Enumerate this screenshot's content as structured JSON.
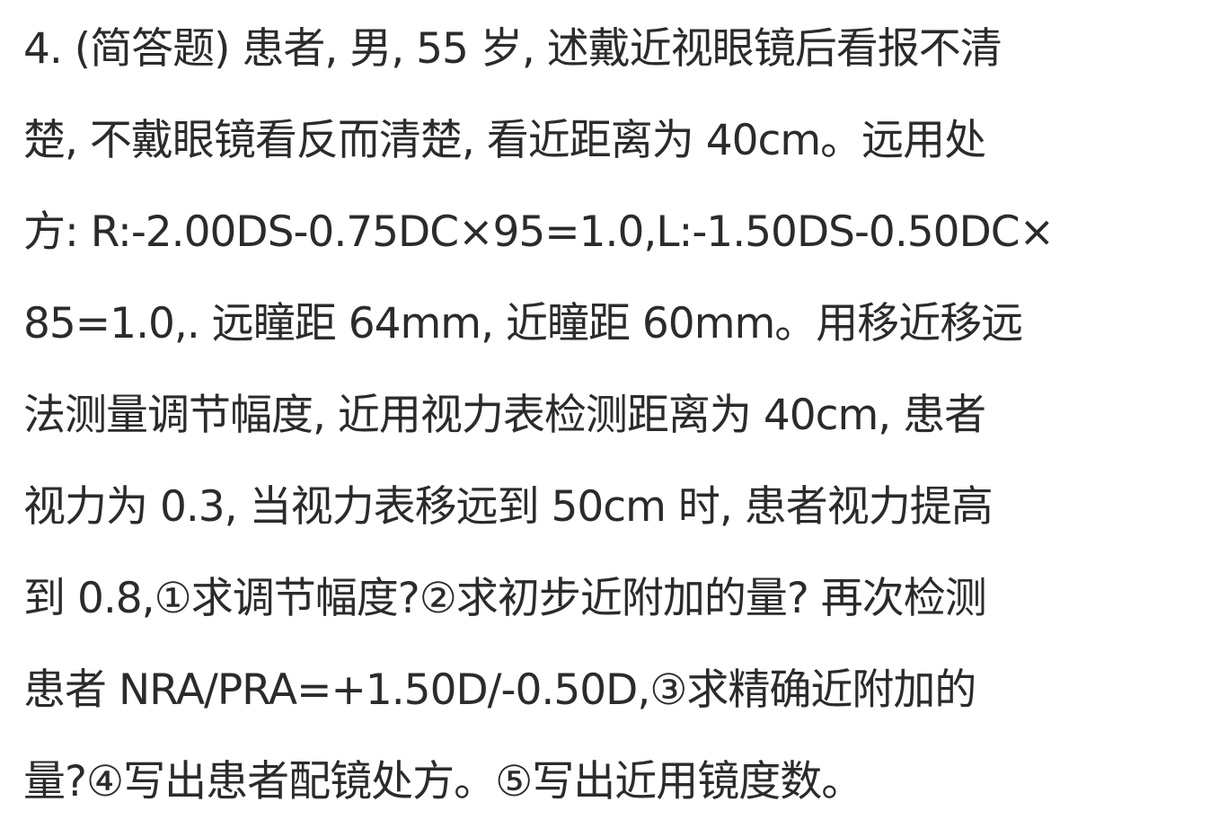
{
  "question": {
    "lines": [
      "4. (简答题) 患者, 男, 55 岁, 述戴近视眼镜后看报不清",
      "楚, 不戴眼镜看反而清楚, 看近距离为 40cm。远用处",
      "方: R:-2.00DS-0.75DC×95=1.0,L:-1.50DS-0.50DC×",
      "85=1.0,. 远瞳距 64mm, 近瞳距 60mm。用移近移远",
      "法测量调节幅度, 近用视力表检测距离为 40cm, 患者",
      "视力为 0.3, 当视力表移远到 50cm 时, 患者视力提高",
      "到 0.8,①求调节幅度?②求初步近附加的量? 再次检测",
      "患者 NRA/PRA=+1.50D/-0.50D,③求精确近附加的",
      "量?④写出患者配镜处方。⑤写出近用镜度数。"
    ]
  }
}
